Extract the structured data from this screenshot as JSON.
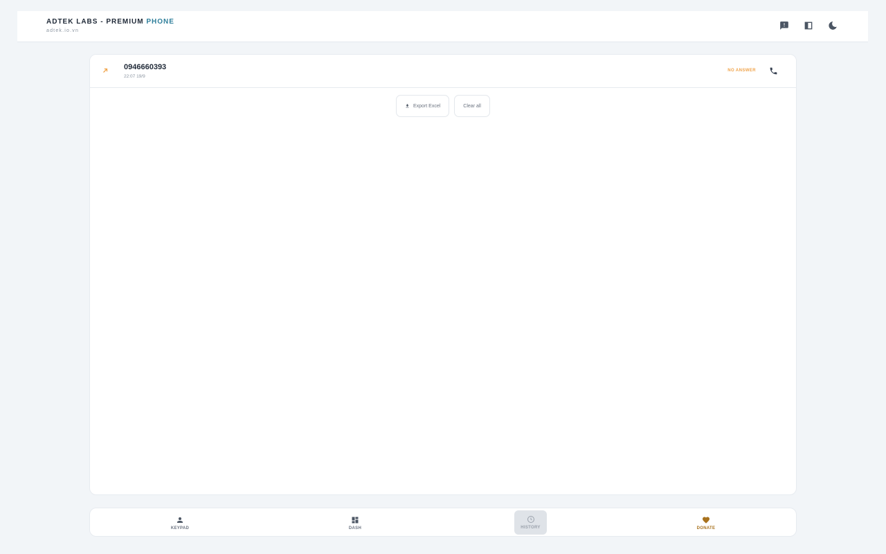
{
  "header": {
    "title_main": "ADTEK LABS - PREMIUM ",
    "title_accent": "PHONE",
    "subtitle": "adtek.io.vn",
    "icons": [
      "feedback-icon",
      "split-view-icon",
      "dark-mode-icon"
    ]
  },
  "calls": [
    {
      "number": "0946660393",
      "time": "22:07 19/9",
      "status": "NO ANSWER",
      "direction": "outgoing",
      "status_color": "#f0a34a"
    }
  ],
  "actions": {
    "export_label": "Export Excel",
    "clear_label": "Clear all"
  },
  "nav": {
    "keypad": "KEYPAD",
    "dash": "DASH",
    "history": "HISTORY",
    "donate": "DONATE",
    "active": "history"
  },
  "colors": {
    "accent": "#2f7f9b",
    "warning": "#f0a34a",
    "donate": "#a8721e",
    "background": "#f2f5f8"
  }
}
